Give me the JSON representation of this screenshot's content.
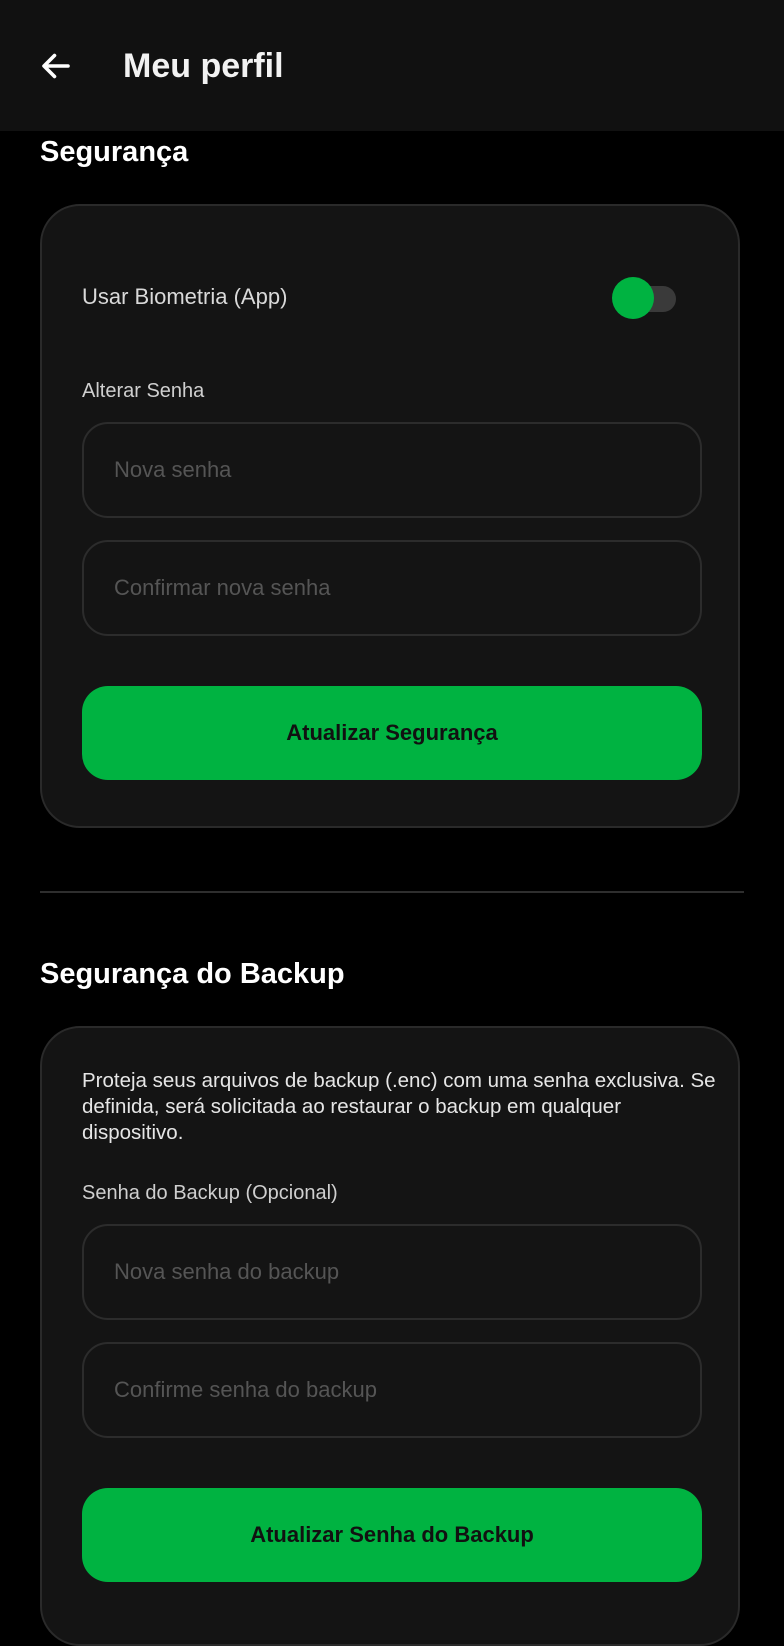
{
  "header": {
    "title": "Meu perfil",
    "back_icon": "arrow-left-icon"
  },
  "security": {
    "title": "Segurança",
    "biometrics_label": "Usar Biometria (App)",
    "biometrics_enabled": true,
    "change_password_label": "Alterar Senha",
    "new_password_placeholder": "Nova senha",
    "confirm_password_placeholder": "Confirmar nova senha",
    "submit_label": "Atualizar Segurança"
  },
  "backup": {
    "title": "Segurança do Backup",
    "description": "Proteja seus arquivos de backup (.enc) com uma senha exclusiva. Se definida, será solicitada ao restaurar o backup em qualquer dispositivo.",
    "password_label": "Senha do Backup (Opcional)",
    "new_password_placeholder": "Nova senha do backup",
    "confirm_password_placeholder": "Confirme senha do backup",
    "submit_label": "Atualizar Senha do Backup"
  },
  "colors": {
    "accent": "#00b341",
    "background": "#000000",
    "card": "#141414",
    "app_bar": "#111111"
  }
}
